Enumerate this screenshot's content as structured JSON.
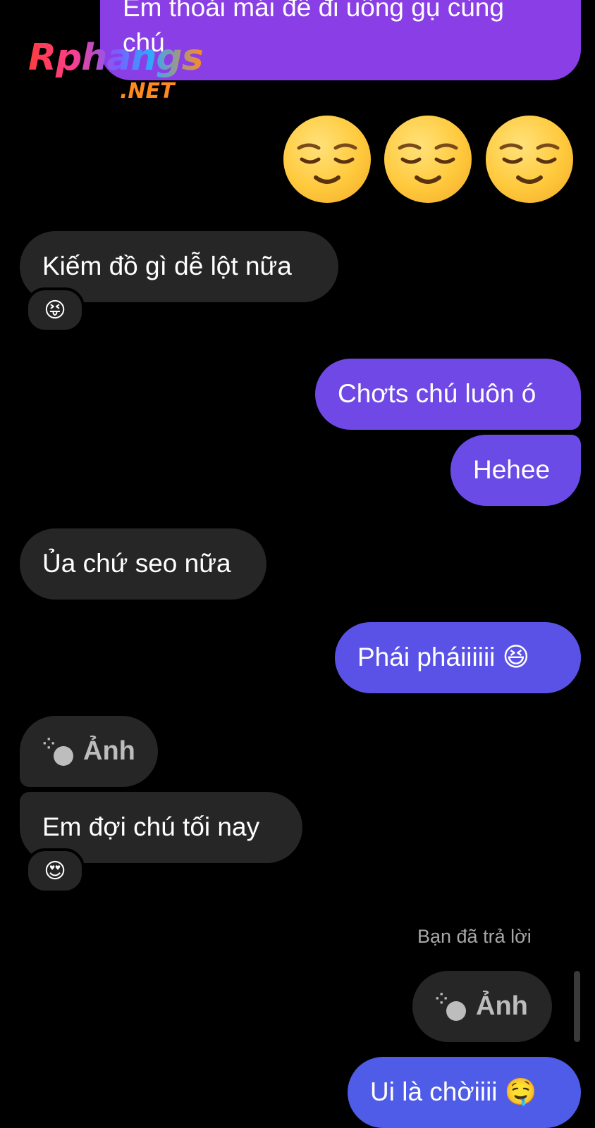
{
  "watermark": {
    "main": "Rphangs",
    "net": ".NET"
  },
  "messages": {
    "top_partial": {
      "line1": "Em thoải mái để đi uống gụ cùng",
      "line2": "chú"
    },
    "big_emojis": [
      "relieved-face-emoji",
      "relieved-face-emoji",
      "relieved-face-emoji"
    ],
    "m1": {
      "text": "Kiếm đồ gì dễ lột nữa",
      "reaction": "😝"
    },
    "m2": {
      "text": "Chơts chú luôn ó"
    },
    "m3": {
      "text": "Hehee"
    },
    "m4": {
      "text": "Ủa chứ seo nữa"
    },
    "m5": {
      "text": "Phái pháiiiiii 😆"
    },
    "m6": {
      "text": "Ảnh"
    },
    "m7": {
      "text": "Em đợi chú tối nay",
      "reaction": "😍"
    },
    "replied_label": "Bạn đã trả lời",
    "m8": {
      "text": "Ảnh"
    },
    "m9": {
      "text": "Ui là chờiiii 🤤"
    }
  },
  "colors": {
    "background": "#000000",
    "incoming_bubble": "#262626",
    "outgoing_top": "#8a3fe6",
    "outgoing_mid": "#6f48e6",
    "outgoing_bottom": "#4f5ce8"
  }
}
